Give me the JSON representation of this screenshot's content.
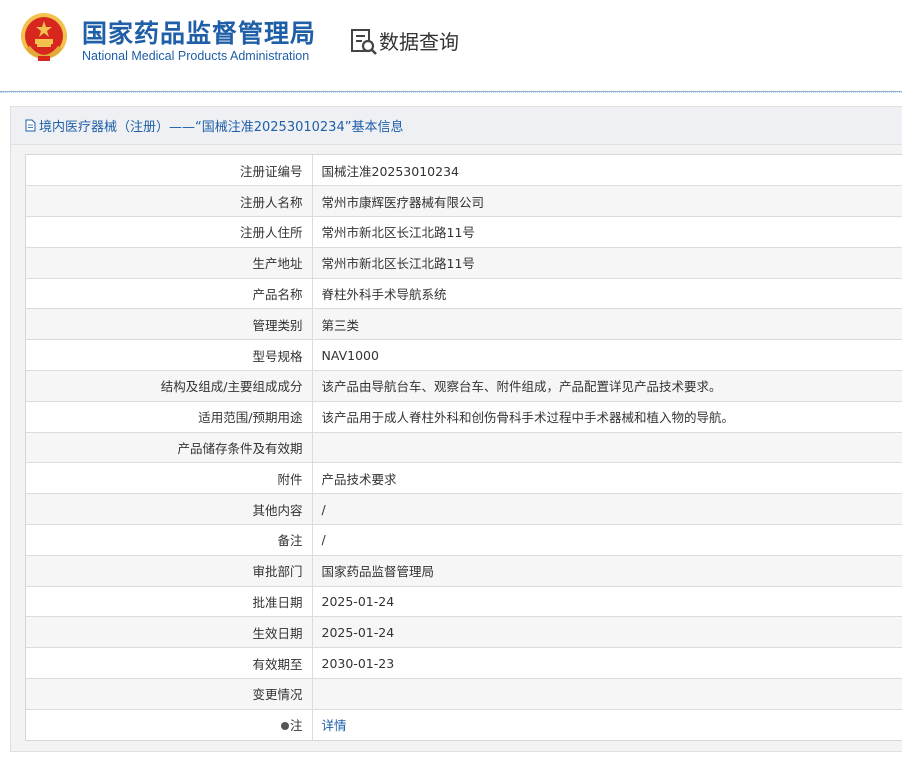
{
  "header": {
    "org_cn": "国家药品监督管理局",
    "org_en": "National Medical Products Administration",
    "query_label": "数据查询"
  },
  "panel": {
    "title": "境内医疗器械（注册）——“国械注准20253010234”基本信息"
  },
  "details": [
    {
      "label": "注册证编号",
      "value": "国械注准20253010234"
    },
    {
      "label": "注册人名称",
      "value": "常州市康辉医疗器械有限公司"
    },
    {
      "label": "注册人住所",
      "value": "常州市新北区长江北路11号"
    },
    {
      "label": "生产地址",
      "value": "常州市新北区长江北路11号"
    },
    {
      "label": "产品名称",
      "value": "脊柱外科手术导航系统"
    },
    {
      "label": "管理类别",
      "value": "第三类"
    },
    {
      "label": "型号规格",
      "value": "NAV1000"
    },
    {
      "label": "结构及组成/主要组成成分",
      "value": "该产品由导航台车、观察台车、附件组成，产品配置详见产品技术要求。"
    },
    {
      "label": "适用范围/预期用途",
      "value": "该产品用于成人脊柱外科和创伤骨科手术过程中手术器械和植入物的导航。"
    },
    {
      "label": "产品储存条件及有效期",
      "value": ""
    },
    {
      "label": "附件",
      "value": "产品技术要求"
    },
    {
      "label": "其他内容",
      "value": "/"
    },
    {
      "label": "备注",
      "value": "/"
    },
    {
      "label": "审批部门",
      "value": "国家药品监督管理局"
    },
    {
      "label": "批准日期",
      "value": "2025-01-24"
    },
    {
      "label": "生效日期",
      "value": "2025-01-24"
    },
    {
      "label": "有效期至",
      "value": "2030-01-23"
    },
    {
      "label": "变更情况",
      "value": ""
    }
  ],
  "note_row": {
    "label": "注",
    "link": "详情"
  },
  "colors": {
    "brand_blue": "#1f5fa8",
    "emblem_red": "#d7261e",
    "emblem_gold": "#f2c14e"
  }
}
